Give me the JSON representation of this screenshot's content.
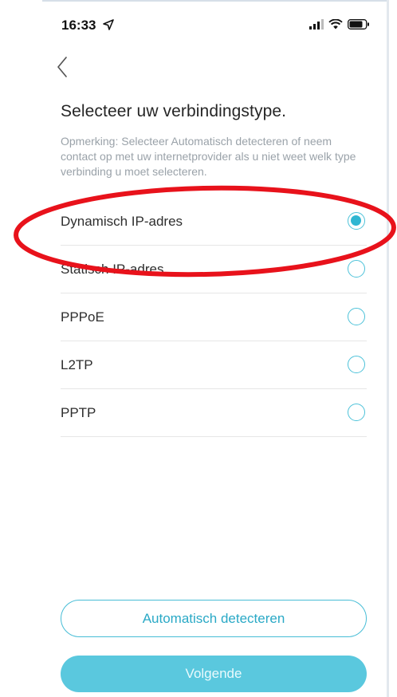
{
  "status_bar": {
    "time": "16:33"
  },
  "header": {
    "title": "Selecteer uw verbindingstype."
  },
  "note": "Opmerking: Selecteer Automatisch detecteren of neem contact op met uw internetprovider als u niet weet welk type verbinding u moet selecteren.",
  "options": [
    {
      "label": "Dynamisch IP-adres",
      "selected": true
    },
    {
      "label": "Statisch IP-adres",
      "selected": false
    },
    {
      "label": "PPPoE",
      "selected": false
    },
    {
      "label": "L2TP",
      "selected": false
    },
    {
      "label": "PPTP",
      "selected": false
    }
  ],
  "buttons": {
    "auto_detect": "Automatisch detecteren",
    "next": "Volgende"
  },
  "colors": {
    "accent": "#2fb6d2",
    "button_fill": "#5ac8de",
    "annotation": "#e8121b"
  }
}
